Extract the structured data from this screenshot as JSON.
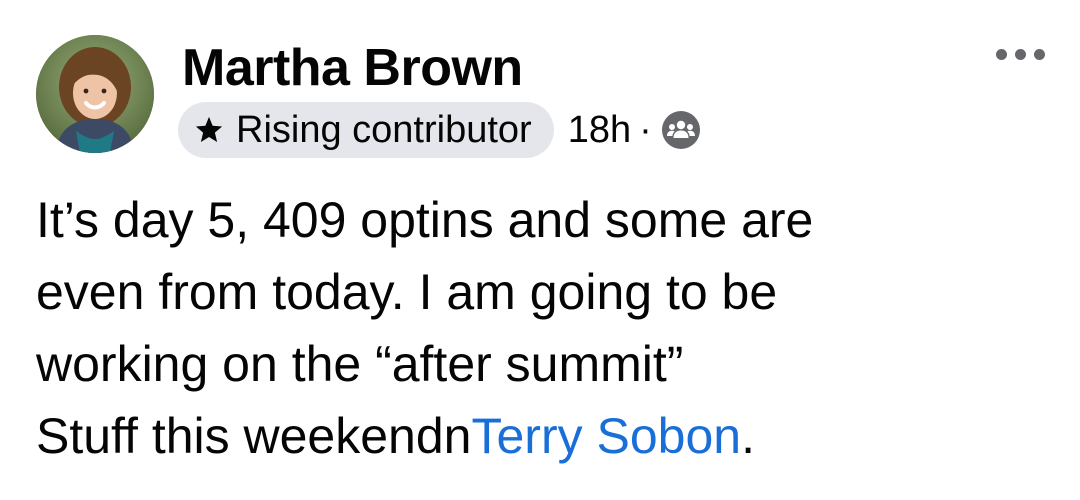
{
  "post": {
    "author": {
      "name": "Martha Brown",
      "badge": "Rising contributor",
      "badge_icon": "star-icon",
      "avatar_icon": "avatar"
    },
    "timestamp": "18h",
    "separator": "·",
    "audience_icon": "group-icon",
    "more_icon": "more-options-icon",
    "body": {
      "line1": "It’s day 5, 409 optins and some are",
      "line2": "even from today. I am going to be",
      "line3": "working on the “after summit”",
      "line4_prefix": "Stuff this weekendn",
      "mention": "Terry Sobon",
      "line4_suffix": "."
    },
    "colors": {
      "text": "#050505",
      "secondary": "#65676b",
      "badge_bg": "#e4e6eb",
      "link": "#1a6ed8"
    }
  }
}
